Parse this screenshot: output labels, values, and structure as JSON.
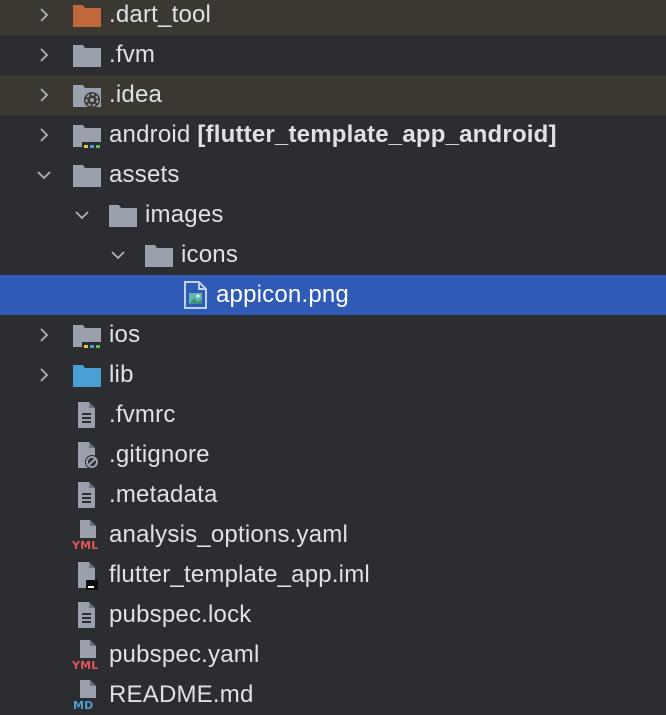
{
  "colors": {
    "background": "#2b2d30",
    "excluded_row": "#3b3832",
    "selected_row": "#2f5bb6",
    "folder": "#9aa1ac",
    "excluded_folder": "#c0683c",
    "source_folder": "#4a9fd3",
    "text": "#dfe1e5"
  },
  "tree": {
    "items": [
      {
        "label": ".dart_tool",
        "icon": "excluded-folder-icon",
        "expanded": false
      },
      {
        "label": ".fvm",
        "icon": "folder-icon",
        "expanded": false
      },
      {
        "label": ".idea",
        "icon": "settings-folder-icon",
        "expanded": false
      },
      {
        "label": "android",
        "module": "[flutter_template_app_android]",
        "icon": "module-folder-icon",
        "expanded": false
      },
      {
        "label": "assets",
        "icon": "folder-icon",
        "expanded": true
      },
      {
        "label": "images",
        "icon": "folder-icon",
        "expanded": true
      },
      {
        "label": "icons",
        "icon": "folder-icon",
        "expanded": true
      },
      {
        "label": "appicon.png",
        "icon": "image-file-icon",
        "selected": true
      },
      {
        "label": "ios",
        "icon": "module-folder-icon",
        "expanded": false
      },
      {
        "label": "lib",
        "icon": "source-folder-icon",
        "expanded": false
      },
      {
        "label": ".fvmrc",
        "icon": "text-file-icon"
      },
      {
        "label": ".gitignore",
        "icon": "ignore-file-icon"
      },
      {
        "label": ".metadata",
        "icon": "text-file-icon"
      },
      {
        "label": "analysis_options.yaml",
        "icon": "yaml-file-icon"
      },
      {
        "label": "flutter_template_app.iml",
        "icon": "iml-file-icon"
      },
      {
        "label": "pubspec.lock",
        "icon": "text-file-icon"
      },
      {
        "label": "pubspec.yaml",
        "icon": "yaml-file-icon"
      },
      {
        "label": "README.md",
        "icon": "markdown-file-icon"
      }
    ]
  }
}
